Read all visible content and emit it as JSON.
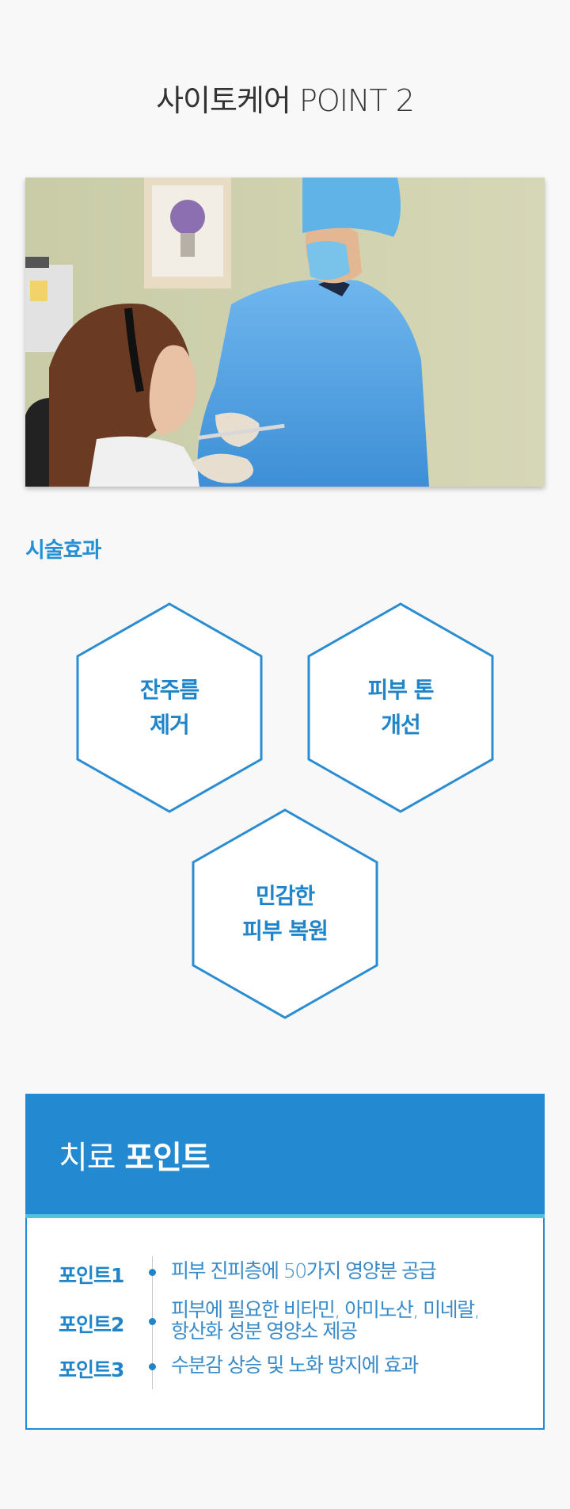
{
  "page": {
    "title": "사이토케어 POINT 2"
  },
  "effects": {
    "heading": "시술효과",
    "items": [
      {
        "line1": "잔주름",
        "line2": "제거"
      },
      {
        "line1": "피부 톤",
        "line2": "개선"
      },
      {
        "line1": "민감한",
        "line2": "피부 복원"
      }
    ]
  },
  "treatment": {
    "title_light": "치료",
    "title_bold": "포인트",
    "points": [
      {
        "name": "포인트1",
        "text1": "피부 진피층에 50가지 영양분 공급",
        "text2": ""
      },
      {
        "name": "포인트2",
        "text1": "피부에 필요한 비타민, 아미노산, 미네랄,",
        "text2": "항산화 성분 영양소 제공"
      },
      {
        "name": "포인트3",
        "text1": "수분감 상승 및 노화 방지에 효과",
        "text2": ""
      }
    ]
  },
  "colors": {
    "accent": "#2389d0",
    "accent_text": "#1f84c8",
    "stripe": "#4fc3d9"
  }
}
